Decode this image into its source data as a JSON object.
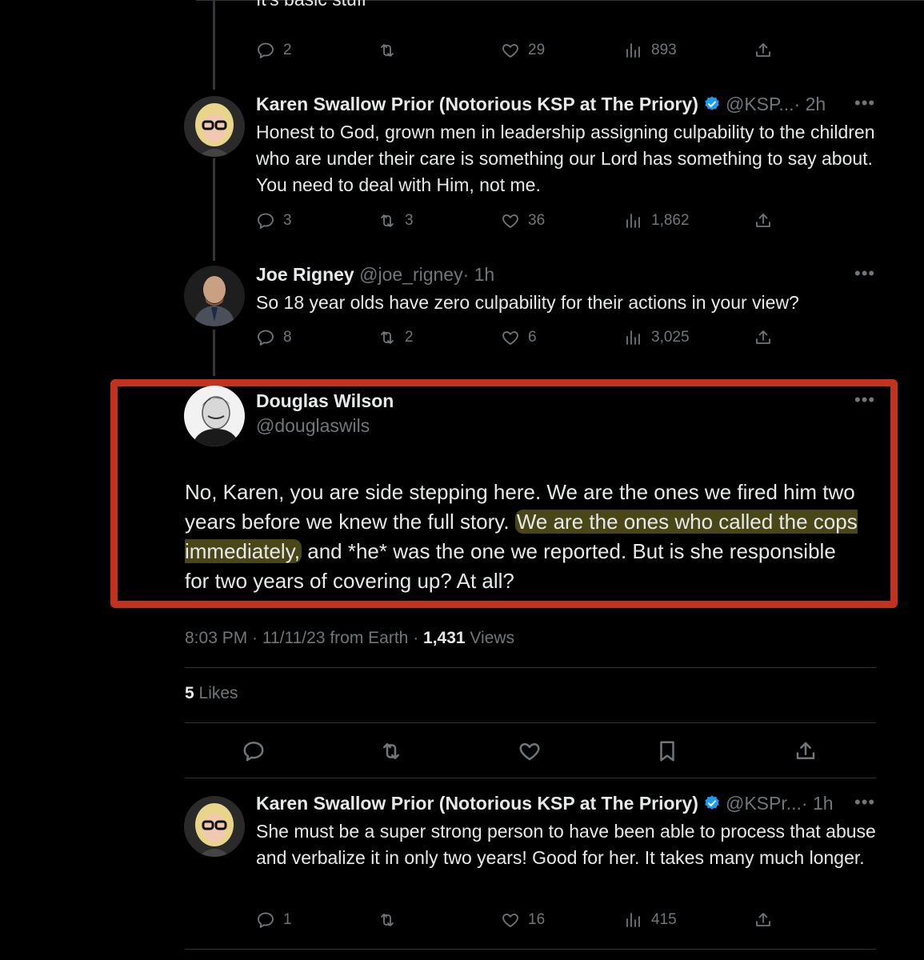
{
  "top_tweet": {
    "cut_text": "It's basic stuff",
    "replies": "2",
    "retweets": "",
    "likes": "29",
    "views": "893"
  },
  "tweet_karen_1": {
    "name": "Karen Swallow Prior (Notorious KSP at The Priory)",
    "handle": "@KSP...",
    "time": "· 2h",
    "text": "Honest to God, grown men in leadership assigning culpability to the children who are under their care is something our Lord has something to say about. You need to deal with Him, not me.",
    "replies": "3",
    "retweets": "3",
    "likes": "36",
    "views": "1,862"
  },
  "tweet_joe": {
    "name": "Joe Rigney",
    "handle": "@joe_rigney",
    "time": "· 1h",
    "text": "So 18 year olds have zero culpability for their actions in your view?",
    "replies": "8",
    "retweets": "2",
    "likes": "6",
    "views": "3,025"
  },
  "main_tweet": {
    "name": "Douglas Wilson",
    "handle": "@douglaswils",
    "text_part1": "No, Karen, you are side stepping here. We are the ones we fired him two years before we knew the full story.",
    "text_highlight": "We are the ones who called the cops immediately,",
    "text_part2": "and *he* was the one we reported. But is she responsible for two years of covering up? At all?",
    "meta_time": "8:03 PM · 11/11/23 from Earth · ",
    "views_count": "1,431",
    "views_label": " Views",
    "likes_count": "5",
    "likes_label": " Likes"
  },
  "tweet_karen_2": {
    "name": "Karen Swallow Prior (Notorious KSP at The Priory)",
    "handle": "@KSPr...",
    "time": "· 1h",
    "text": "She must be a super strong person to have been able to process that abuse and verbalize it in only two years! Good for her. It takes many much longer.",
    "replies": "1",
    "retweets": "",
    "likes": "16",
    "views": "415"
  },
  "colors": {
    "background": "#000000",
    "text": "#e7e9ea",
    "muted": "#71767b",
    "verified": "#1d9bf0",
    "annotation_box": "#c2331f",
    "highlight": "#d2c846"
  },
  "icons": [
    "reply-icon",
    "retweet-icon",
    "like-icon",
    "views-icon",
    "share-icon",
    "bookmark-icon",
    "more-icon",
    "verified-badge-icon"
  ]
}
